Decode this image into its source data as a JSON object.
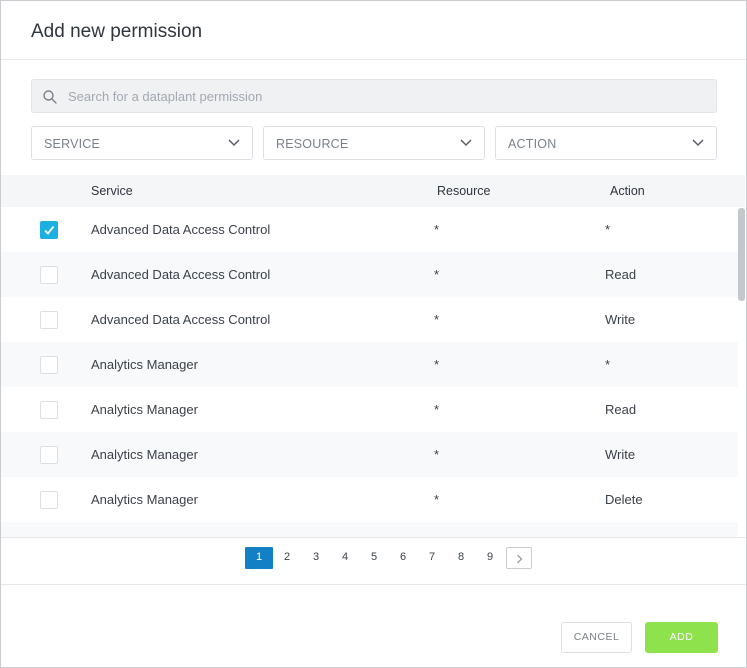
{
  "dialog": {
    "title": "Add new permission"
  },
  "search": {
    "placeholder": "Search for a dataplant permission",
    "value": ""
  },
  "filters": [
    {
      "label": "SERVICE"
    },
    {
      "label": "RESOURCE"
    },
    {
      "label": "ACTION"
    }
  ],
  "table": {
    "columns": [
      "Service",
      "Resource",
      "Action"
    ],
    "rows": [
      {
        "checked": true,
        "service": "Advanced Data Access Control",
        "resource": "*",
        "action": "*"
      },
      {
        "checked": false,
        "service": "Advanced Data Access Control",
        "resource": "*",
        "action": "Read"
      },
      {
        "checked": false,
        "service": "Advanced Data Access Control",
        "resource": "*",
        "action": "Write"
      },
      {
        "checked": false,
        "service": "Analytics Manager",
        "resource": "*",
        "action": "*"
      },
      {
        "checked": false,
        "service": "Analytics Manager",
        "resource": "*",
        "action": "Read"
      },
      {
        "checked": false,
        "service": "Analytics Manager",
        "resource": "*",
        "action": "Write"
      },
      {
        "checked": false,
        "service": "Analytics Manager",
        "resource": "*",
        "action": "Delete"
      }
    ]
  },
  "pagination": {
    "current": "1",
    "pages": [
      "1",
      "2",
      "3",
      "4",
      "5",
      "6",
      "7",
      "8",
      "9"
    ],
    "next_icon": "chevron-right-icon"
  },
  "buttons": {
    "cancel_label": "CANCEL",
    "add_label": "ADD"
  },
  "colors": {
    "accent": "#1cb0e0",
    "pager_active": "#1380c6",
    "add_button": "#8ee34d"
  }
}
